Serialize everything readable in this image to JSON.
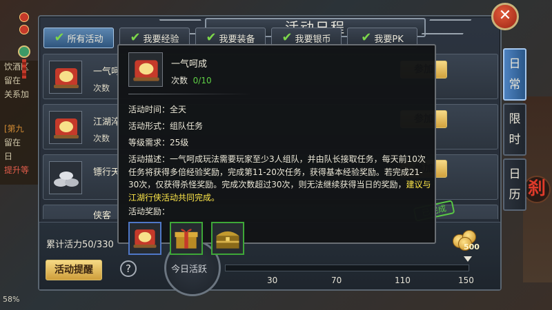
{
  "window": {
    "title": "活动日程"
  },
  "tabs": [
    {
      "label": "所有活动",
      "active": true
    },
    {
      "label": "我要经验",
      "active": false
    },
    {
      "label": "我要装备",
      "active": false
    },
    {
      "label": "我要银币",
      "active": false
    },
    {
      "label": "我要PK",
      "active": false
    }
  ],
  "side_tabs": [
    {
      "label": "日常",
      "active": true
    },
    {
      "label": "限时",
      "active": false
    },
    {
      "label": "日历",
      "active": false
    }
  ],
  "activities": [
    {
      "name": "一气呵",
      "count_label": "次数",
      "button": "参加",
      "icon": "scroll-icon"
    },
    {
      "name": "江湖淬",
      "count_label": "次数",
      "button": "参加",
      "icon": "scroll-icon"
    },
    {
      "name": "镖行天",
      "count_label": "次数",
      "button": "参加",
      "icon": "silver-coins-icon"
    },
    {
      "name": "侠客",
      "count_label": "",
      "button": "",
      "icon": ""
    }
  ],
  "done_stamp": "已完成",
  "background_chat": {
    "lines": [
      "饮酒区",
      "留在",
      "关系加",
      "[第九",
      "留在",
      "日",
      "提升等"
    ],
    "percent": "58%"
  },
  "bottom": {
    "vitality_label": "累计活力50/330",
    "remind_button": "活动提醒",
    "help_icon": "?",
    "today_label": "今日活跃",
    "progress": 0.0,
    "milestones": [
      "30",
      "70",
      "110",
      "150"
    ],
    "chest_reward": "500"
  },
  "tooltip": {
    "title": "一气呵成",
    "count_label": "次数",
    "count_value": "0/10",
    "time_label": "活动时间：全天",
    "form_label": "活动形式：组队任务",
    "level_label": "等级需求：25级",
    "desc_prefix": "活动描述：一气呵成玩法需要玩家至少3人组队，并由队长接取任务，每天前10次任务将获得多倍经验奖励，完成第11-20次任务，获得基本经验奖励。若完成21-30次，仅获得杀怪奖励。完成次数超过30次，则无法继续获得当日的奖励，",
    "desc_highlight": "建议与江湖行侠活动共同完成。",
    "reward_label": "活动奖励：",
    "rewards": [
      {
        "icon": "scroll-icon",
        "rarity": "blue"
      },
      {
        "icon": "gift-box-icon",
        "rarity": "green"
      },
      {
        "icon": "treasure-chest-icon",
        "rarity": "green"
      }
    ]
  },
  "colors": {
    "active_tab": "#3f6f9f",
    "gold_button": "#e9c66a",
    "count_green": "#5fd046",
    "highlight_yellow": "#ffe84a"
  }
}
